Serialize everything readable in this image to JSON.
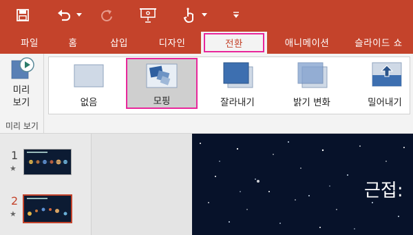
{
  "app": {
    "accent_color": "#c4432b",
    "highlight_color": "#e8259a"
  },
  "quick_access": {
    "items": [
      {
        "name": "save",
        "icon": "save-icon"
      },
      {
        "name": "undo",
        "icon": "undo-icon"
      },
      {
        "name": "undo-dropdown",
        "icon": "chevron-down-icon"
      },
      {
        "name": "redo",
        "icon": "redo-icon"
      },
      {
        "name": "present",
        "icon": "presenter-icon"
      },
      {
        "name": "touch-mode",
        "icon": "touch-icon"
      },
      {
        "name": "touch-dropdown",
        "icon": "chevron-down-icon"
      },
      {
        "name": "customize",
        "icon": "customize-qat-icon"
      }
    ]
  },
  "tabs": {
    "items": [
      {
        "label": "파일"
      },
      {
        "label": "홈"
      },
      {
        "label": "삽입"
      },
      {
        "label": "디자인"
      },
      {
        "label": "전환",
        "active": true
      },
      {
        "label": "애니메이션"
      },
      {
        "label": "슬라이드 쇼"
      }
    ]
  },
  "ribbon": {
    "preview_group": {
      "button_label_line1": "미리",
      "button_label_line2": "보기",
      "group_label": "미리 보기"
    },
    "transitions": [
      {
        "label": "없음",
        "icon": "transition-none-icon"
      },
      {
        "label": "모핑",
        "icon": "transition-morph-icon",
        "selected": true
      },
      {
        "label": "잘라내기",
        "icon": "transition-cut-icon"
      },
      {
        "label": "밝기 변화",
        "icon": "transition-fade-icon"
      },
      {
        "label": "밀어내기",
        "icon": "transition-push-icon"
      }
    ]
  },
  "slides": {
    "items": [
      {
        "number": "1",
        "has_transition": true
      },
      {
        "number": "2",
        "has_transition": true,
        "selected": true
      }
    ]
  },
  "current_slide": {
    "title_visible": "근접:"
  }
}
